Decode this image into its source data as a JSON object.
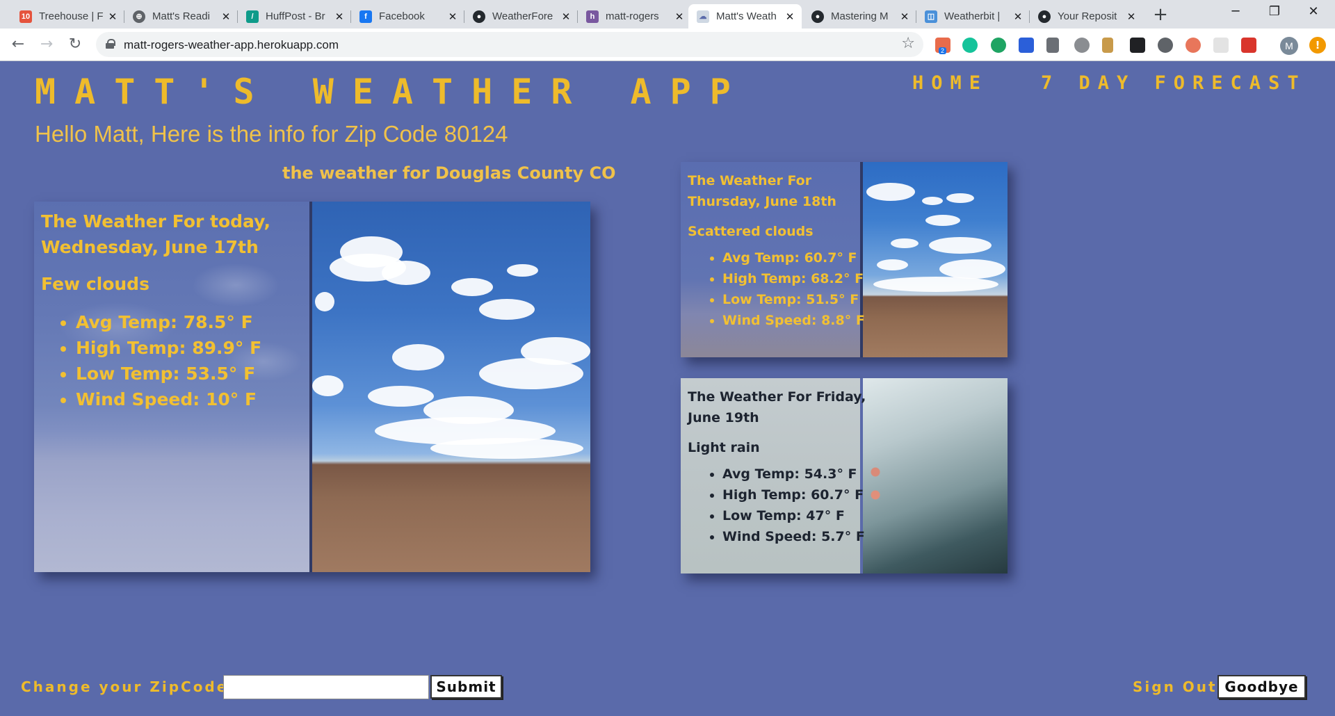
{
  "browser": {
    "tabs": [
      {
        "label": "Treehouse | F",
        "fav_color": "#e5533d",
        "fav_text": "10"
      },
      {
        "label": "Matt's Readi",
        "fav_color": "#5f6368",
        "fav_text": "⊕"
      },
      {
        "label": "HuffPost - Br",
        "fav_color": "#0e9b8a",
        "fav_text": "/"
      },
      {
        "label": "Facebook",
        "fav_color": "#1877f2",
        "fav_text": "f"
      },
      {
        "label": "WeatherFore",
        "fav_color": "#24292e",
        "fav_text": "●"
      },
      {
        "label": "matt-rogers",
        "fav_color": "#79589f",
        "fav_text": "h"
      },
      {
        "label": "Matt's Weath",
        "fav_color": "#cfd8e3",
        "fav_text": "☁"
      },
      {
        "label": "Mastering M",
        "fav_color": "#24292e",
        "fav_text": "●"
      },
      {
        "label": "Weatherbit |",
        "fav_color": "#4a90d9",
        "fav_text": "◫"
      },
      {
        "label": "Your Reposit",
        "fav_color": "#24292e",
        "fav_text": "●"
      }
    ],
    "new_tab": "+",
    "url": "matt-rogers-weather-app.herokuapp.com",
    "ext_badge": "2",
    "profile_initial": "M"
  },
  "site": {
    "brand": "MATT'S WEATHER APP",
    "nav_home": "HOME",
    "nav_forecast": "7 DAY FORECAST",
    "greeting": "Hello Matt, Here is the info for Zip Code 80124",
    "county": "the weather for Douglas County CO"
  },
  "today": {
    "title_line1": "The Weather For today,",
    "title_line2": "Wednesday, June 17th",
    "condition": "Few clouds",
    "stats": [
      "Avg Temp: 78.5° F",
      "High Temp: 89.9° F",
      "Low Temp: 53.5° F",
      "Wind Speed: 10° F"
    ]
  },
  "thursday": {
    "title_line1": "The Weather For",
    "title_line2": "Thursday, June 18th",
    "condition": "Scattered clouds",
    "stats": [
      "Avg Temp: 60.7° F",
      "High Temp: 68.2° F",
      "Low Temp: 51.5° F",
      "Wind Speed: 8.8° F"
    ]
  },
  "friday": {
    "title_line1": "The Weather For Friday,",
    "title_line2": "June 19th",
    "condition": "Light rain",
    "stats": [
      "Avg Temp: 54.3° F",
      "High Temp: 60.7° F",
      "Low Temp: 47° F",
      "Wind Speed: 5.7° F"
    ]
  },
  "form": {
    "zip_label": "Change your ZipCode!",
    "zip_value": "",
    "submit_label": "Submit",
    "signout_label": "Sign Out",
    "goodbye_label": "Goodbye"
  },
  "colors": {
    "page_bg": "#5a6aaa",
    "accent": "#eebb2b"
  }
}
